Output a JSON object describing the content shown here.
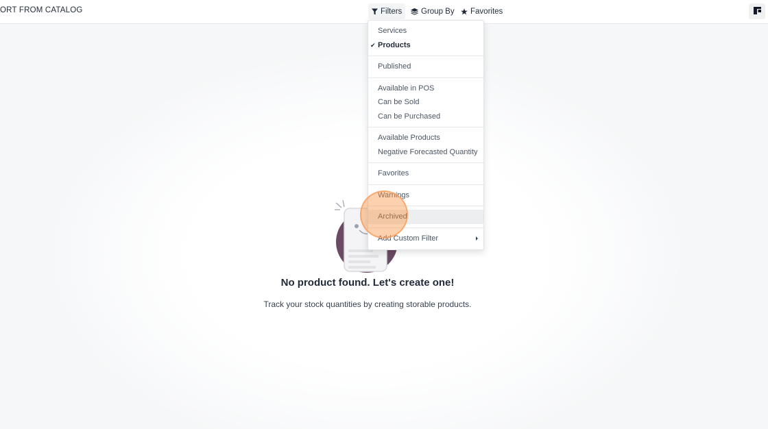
{
  "topbar": {
    "import_label": "ORT FROM CATALOG",
    "filters_label": "Filters",
    "groupby_label": "Group By",
    "favorites_label": "Favorites",
    "filter_icon": "funnel-icon",
    "groupby_icon": "layers-icon",
    "favorites_icon": "star-icon",
    "layout_icon": "layout-panel-icon"
  },
  "filters_menu": {
    "groups": [
      [
        {
          "label": "Services",
          "checked": false
        },
        {
          "label": "Products",
          "checked": true
        }
      ],
      [
        {
          "label": "Published",
          "checked": false
        }
      ],
      [
        {
          "label": "Available in POS",
          "checked": false
        },
        {
          "label": "Can be Sold",
          "checked": false
        },
        {
          "label": "Can be Purchased",
          "checked": false
        }
      ],
      [
        {
          "label": "Available Products",
          "checked": false
        },
        {
          "label": "Negative Forecasted Quantity",
          "checked": false
        }
      ],
      [
        {
          "label": "Favorites",
          "checked": false
        }
      ],
      [
        {
          "label": "Warnings",
          "checked": false
        }
      ],
      [
        {
          "label": "Archived",
          "checked": false,
          "hovered": true
        }
      ]
    ],
    "custom_filter_label": "Add Custom Filter",
    "check_icon": "checkmark-icon",
    "submenu_icon": "caret-right-icon"
  },
  "empty_state": {
    "title": "No product found. Let's create one!",
    "description": "Track your stock quantities by creating storable products."
  },
  "colors": {
    "accent_circle": "#6b4a63",
    "click_highlight": "#fb923c"
  }
}
